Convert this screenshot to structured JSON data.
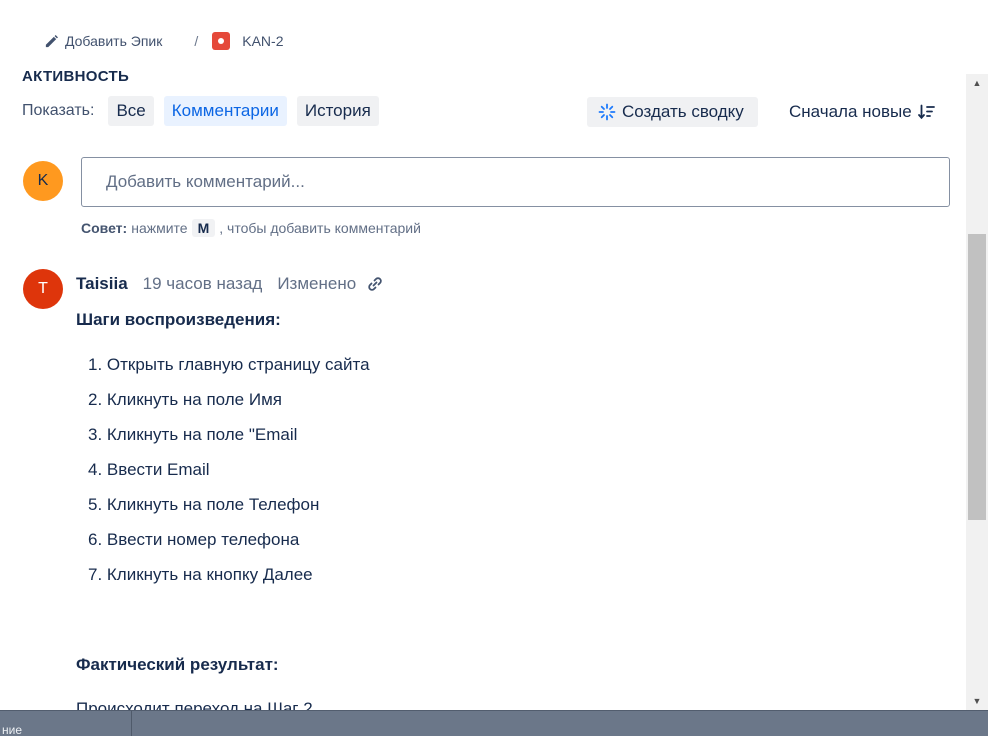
{
  "breadcrumb": {
    "add_epic": "Добавить Эпик",
    "separator": "/",
    "issue_key": "KAN-2"
  },
  "activity": {
    "title": "Активность",
    "show_label": "Показать:",
    "filters": [
      {
        "label": "Все",
        "active": false
      },
      {
        "label": "Комментарии",
        "active": true
      },
      {
        "label": "История",
        "active": false
      }
    ],
    "summary_button": "Создать сводку",
    "sort_button": "Сначала новые"
  },
  "composer": {
    "avatar_initial": "K",
    "placeholder": "Добавить комментарий...",
    "tip_label": "Совет:",
    "tip_before": "нажмите",
    "tip_key": "M",
    "tip_after": ", чтобы добавить комментарий"
  },
  "comment": {
    "avatar_initial": "T",
    "author": "Taisiia",
    "time": "19 часов назад",
    "edited": "Изменено",
    "steps_heading": "Шаги воспроизведения:",
    "steps": [
      "1.  Открыть главную страницу сайта",
      "2. Кликнуть на поле Имя",
      "3. Кликнуть на поле \"Email",
      "4. Ввести Email",
      "5. Кликнуть на поле Телефон",
      "6. Ввести номер телефона",
      "7. Кликнуть на кнопку Далее"
    ],
    "actual_heading": "Фактический результат:",
    "actual_text": "Происходит переход на Шаг 2"
  },
  "taskbar": {
    "partial_label": "ние"
  },
  "colors": {
    "accent": "#0c66e4",
    "my_avatar": "#ff991f",
    "author_avatar": "#de350b",
    "bug_icon": "#e5493a"
  },
  "icons": [
    "pencil-icon",
    "bug-icon",
    "sparkle-icon",
    "sort-icon",
    "link-icon"
  ]
}
